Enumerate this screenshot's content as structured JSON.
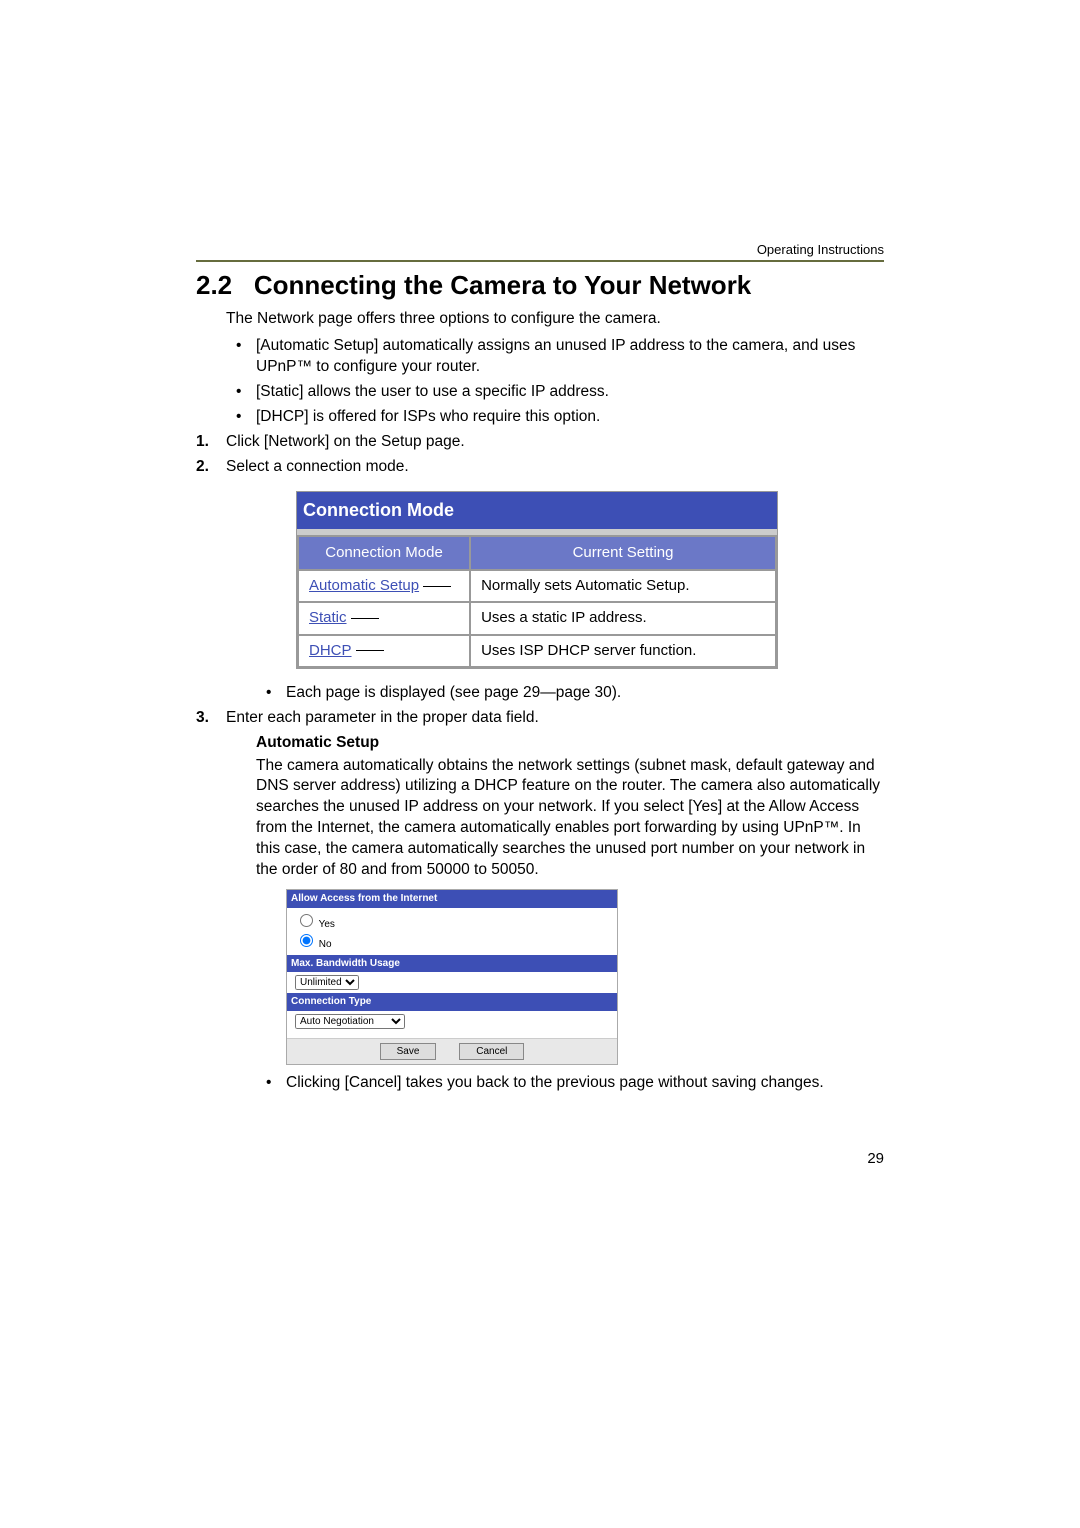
{
  "header": "Operating Instructions",
  "section": {
    "number": "2.2",
    "title": "Connecting the Camera to Your Network"
  },
  "intro": "The Network page offers three options to configure the camera.",
  "bullets_top": [
    "[Automatic Setup] automatically assigns an unused IP address to the camera, and uses UPnP™ to configure your router.",
    "[Static] allows the user to use a specific IP address.",
    "[DHCP] is offered for ISPs who require this option."
  ],
  "steps": {
    "s1": "Click [Network] on the Setup page.",
    "s2": "Select a connection mode.",
    "s2_note": "Each page is displayed (see page 29—page 30).",
    "s3": "Enter each parameter in the proper data field."
  },
  "fig": {
    "caption": "Connection Mode",
    "col1": "Connection Mode",
    "col2": "Current Setting",
    "rows": [
      {
        "link": "Automatic Setup",
        "desc": "Normally sets Automatic Setup."
      },
      {
        "link": "Static",
        "desc": "Uses a static IP address."
      },
      {
        "link": "DHCP",
        "desc": "Uses ISP DHCP server function."
      }
    ]
  },
  "autosetup": {
    "heading": "Automatic Setup",
    "para": "The camera automatically obtains the network settings (subnet mask, default gateway and DNS server address) utilizing a DHCP feature on the router. The camera also automatically searches the unused IP address on your network. If you select [Yes] at the Allow Access from the Internet, the camera automatically enables port forwarding by using UPnP™. In this case, the camera automatically searches the unused port number on your network in the order of 80 and from 50000 to 50050."
  },
  "form": {
    "panel1": "Allow Access from the Internet",
    "yes": "Yes",
    "no": "No",
    "panel2": "Max. Bandwidth Usage",
    "bw_value": "Unlimited",
    "panel3": "Connection Type",
    "ct_value": "Auto Negotiation",
    "save": "Save",
    "cancel": "Cancel"
  },
  "cancel_note": "Clicking [Cancel] takes you back to the previous page without saving changes.",
  "pagenum": "29"
}
